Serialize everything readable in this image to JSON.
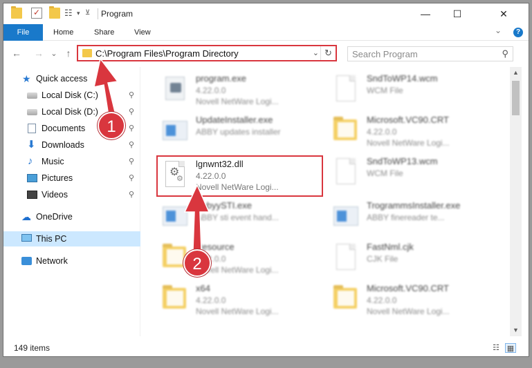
{
  "window": {
    "title": "Program",
    "controls": {
      "minimize": "—",
      "maximize": "☐",
      "close": "✕"
    }
  },
  "quick_access_toolbar": {
    "items": [
      "folder-icon",
      "checkmark-icon",
      "folder-icon",
      "properties-icon",
      "dropdown-icon"
    ]
  },
  "ribbon": {
    "tabs": [
      {
        "label": "File",
        "active": true
      },
      {
        "label": "Home"
      },
      {
        "label": "Share"
      },
      {
        "label": "View"
      }
    ],
    "expand_glyph": "⌄",
    "help_glyph": "?"
  },
  "navigation": {
    "back_glyph": "←",
    "forward_glyph": "→",
    "recent_glyph": "⌄",
    "up_glyph": "↑",
    "address_path": "C:\\Program Files\\Program Directory",
    "address_drop_glyph": "⌄",
    "refresh_glyph": "↻",
    "search_placeholder": "Search Program",
    "search_glyph": "⚲"
  },
  "sidebar": {
    "items": [
      {
        "label": "Quick access",
        "icon": "star-icon",
        "pinned": false
      },
      {
        "label": "Local Disk (C:)",
        "icon": "drive-icon",
        "pinned": true
      },
      {
        "label": "Local Disk (D:)",
        "icon": "drive-icon",
        "pinned": true
      },
      {
        "label": "Documents",
        "icon": "documents-icon",
        "pinned": true
      },
      {
        "label": "Downloads",
        "icon": "download-icon",
        "pinned": true
      },
      {
        "label": "Music",
        "icon": "music-icon",
        "pinned": true
      },
      {
        "label": "Pictures",
        "icon": "pictures-icon",
        "pinned": true
      },
      {
        "label": "Videos",
        "icon": "videos-icon",
        "pinned": true
      },
      {
        "label": "OneDrive",
        "icon": "cloud-icon",
        "pinned": false
      },
      {
        "label": "This PC",
        "icon": "computer-icon",
        "pinned": false,
        "selected": true
      },
      {
        "label": "Network",
        "icon": "network-icon",
        "pinned": false
      }
    ],
    "pin_glyph": "📌"
  },
  "files": [
    {
      "name": "program.exe",
      "line1": "4.22.0.0",
      "line2": "Novell NetWare Logi...",
      "icon": "exe-icon",
      "blurred": true
    },
    {
      "name": "SndToWP14.wcm",
      "line1": "WCM File",
      "line2": "",
      "icon": "file-icon",
      "blurred": true
    },
    {
      "name": "UpdateInstaller.exe",
      "line1": "ABBY updates installer",
      "line2": "",
      "icon": "installer-icon",
      "blurred": true
    },
    {
      "name": "Microsoft.VC90.CRT",
      "line1": "4.22.0.0",
      "line2": "Novell NetWare Logi...",
      "icon": "folder-icon",
      "blurred": true
    },
    {
      "name": "lgnwnt32.dll",
      "line1": "4.22.0.0",
      "line2": "Novell NetWare Logi...",
      "icon": "dll-gear-icon",
      "blurred": false,
      "highlighted": true
    },
    {
      "name": "SndToWP13.wcm",
      "line1": "WCM File",
      "line2": "",
      "icon": "file-icon",
      "blurred": true
    },
    {
      "name": "AbbyySTI.exe",
      "line1": "ABBY sti event hand...",
      "line2": "",
      "icon": "installer-icon",
      "blurred": true
    },
    {
      "name": "TrogrammsInstaller.exe",
      "line1": "ABBY finereader te...",
      "line2": "",
      "icon": "installer-icon",
      "blurred": true
    },
    {
      "name": "Resource",
      "line1": "4.22.0.0",
      "line2": "Novell NetWare Logi...",
      "icon": "folder-icon",
      "blurred": true
    },
    {
      "name": "FastNml.cjk",
      "line1": "CJK File",
      "line2": "",
      "icon": "file-icon",
      "blurred": true
    },
    {
      "name": "x64",
      "line1": "4.22.0.0",
      "line2": "Novell NetWare Logi...",
      "icon": "folder-icon",
      "blurred": true
    },
    {
      "name": "Microsoft.VC90.CRT",
      "line1": "4.22.0.0",
      "line2": "Novell NetWare Logi...",
      "icon": "folder-icon",
      "blurred": true
    }
  ],
  "status": {
    "item_count": "149 items",
    "details_view_glyph": "☷",
    "tiles_view_glyph": "▦"
  },
  "annotations": {
    "badge1": "1",
    "badge2": "2",
    "color": "#d9363e"
  },
  "colors": {
    "accent": "#1979ca",
    "highlight": "#d9363e",
    "selection": "#cce8ff"
  }
}
